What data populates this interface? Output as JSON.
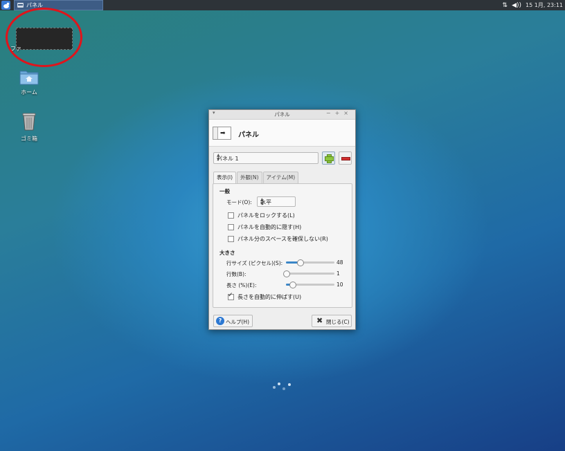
{
  "taskbar": {
    "window_button_label": "パネル",
    "clock": "15 1月, 23:11"
  },
  "desktop": {
    "icons": [
      {
        "label": "ホーム"
      },
      {
        "label": "ゴミ箱"
      }
    ],
    "cut_label": "ファ"
  },
  "dialog": {
    "window_title": "パネル",
    "header_title": "パネル",
    "panel_select": "パネル 1",
    "tabs": [
      {
        "label": "表示(I)",
        "active": true
      },
      {
        "label": "外観(N)",
        "active": false
      },
      {
        "label": "アイテム(M)",
        "active": false
      }
    ],
    "general": {
      "heading": "一般",
      "mode_label": "モード(O):",
      "mode_value": "水平",
      "checkboxes": [
        {
          "label": "パネルをロックする(L)",
          "checked": false
        },
        {
          "label": "パネルを自動的に隠す(H)",
          "checked": false
        },
        {
          "label": "パネル分のスペースを確保しない(R)",
          "checked": false
        }
      ]
    },
    "size": {
      "heading": "大きさ",
      "sliders": [
        {
          "label": "行サイズ (ピクセル)(S):",
          "value": "48",
          "fraction": 0.28
        },
        {
          "label": "行数(B):",
          "value": "1",
          "fraction": 0.0
        },
        {
          "label": "長さ (%)(E):",
          "value": "10",
          "fraction": 0.13
        }
      ],
      "auto_length": {
        "label": "長さを自動的に伸ばす(U)",
        "checked": true
      }
    },
    "help_label": "ヘルプ(H)",
    "close_label": "閉じる(C)"
  },
  "colors": {
    "accent": "#3b86c7",
    "highlight": "#e0141b"
  }
}
